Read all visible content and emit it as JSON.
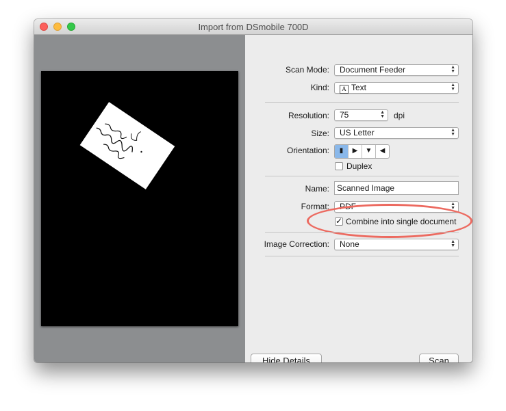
{
  "window": {
    "title": "Import from DSmobile 700D"
  },
  "settings": {
    "scan_mode": {
      "label": "Scan Mode:",
      "value": "Document Feeder"
    },
    "kind": {
      "label": "Kind:",
      "icon": "text-A-icon",
      "value": "Text"
    },
    "resolution": {
      "label": "Resolution:",
      "value": "75",
      "unit": "dpi"
    },
    "size": {
      "label": "Size:",
      "value": "US Letter"
    },
    "orientation": {
      "label": "Orientation:",
      "options": [
        "portrait",
        "landscape-right",
        "portrait-flip",
        "landscape-left"
      ],
      "selected": 0
    },
    "duplex": {
      "label": "Duplex",
      "checked": false
    },
    "name": {
      "label": "Name:",
      "value": "Scanned Image"
    },
    "format": {
      "label": "Format:",
      "value": "PDF"
    },
    "combine": {
      "label": "Combine into single document",
      "checked": true
    },
    "image_correction": {
      "label": "Image Correction:",
      "value": "None"
    }
  },
  "buttons": {
    "hide_details": "Hide Details",
    "scan": "Scan"
  },
  "colors": {
    "highlight_oval": "#ec6a60",
    "selected_segment": "#8ab8ea"
  }
}
